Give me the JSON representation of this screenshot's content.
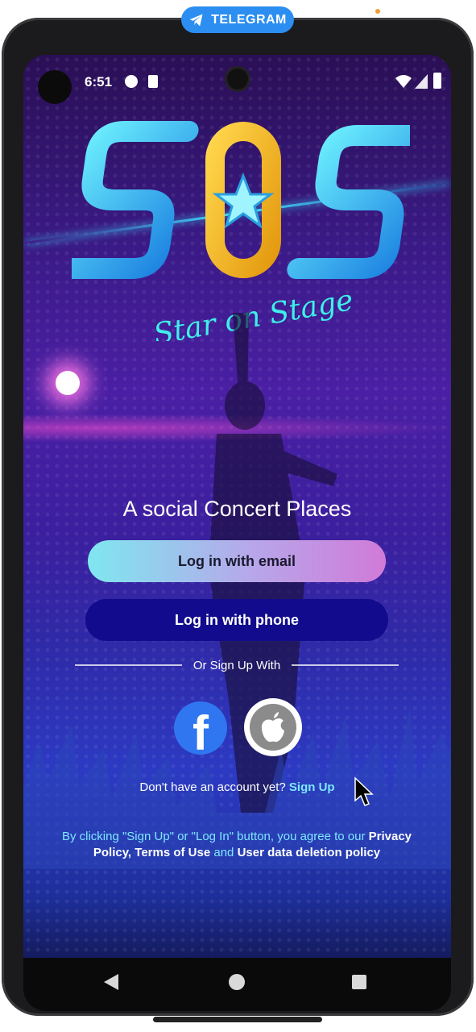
{
  "telegram_badge": {
    "label": "TELEGRAM"
  },
  "status_bar": {
    "time": "6:51"
  },
  "logo": {
    "brand": "SOS",
    "subtitle": "Star on Stage"
  },
  "tagline": "A social Concert Places",
  "buttons": {
    "email_login": "Log in with email",
    "phone_login": "Log in with phone"
  },
  "divider_text": "Or Sign Up With",
  "social": [
    {
      "name": "facebook",
      "icon": "facebook-icon"
    },
    {
      "name": "apple",
      "icon": "apple-icon"
    }
  ],
  "account_prompt": {
    "text": "Don't have an account yet?",
    "link": "Sign Up"
  },
  "terms": {
    "prefix": "By clicking \"Sign Up\" or \"Log In\" button, you agree to our",
    "privacy": "Privacy Policy,",
    "terms_of_use": "Terms of Use",
    "and": "and",
    "deletion": "User data deletion policy"
  },
  "colors": {
    "accent_cyan": "#7ee7ff",
    "phone_button": "#120b8d",
    "facebook_blue": "#2f76f0",
    "telegram_blue": "#2b8ef0"
  }
}
